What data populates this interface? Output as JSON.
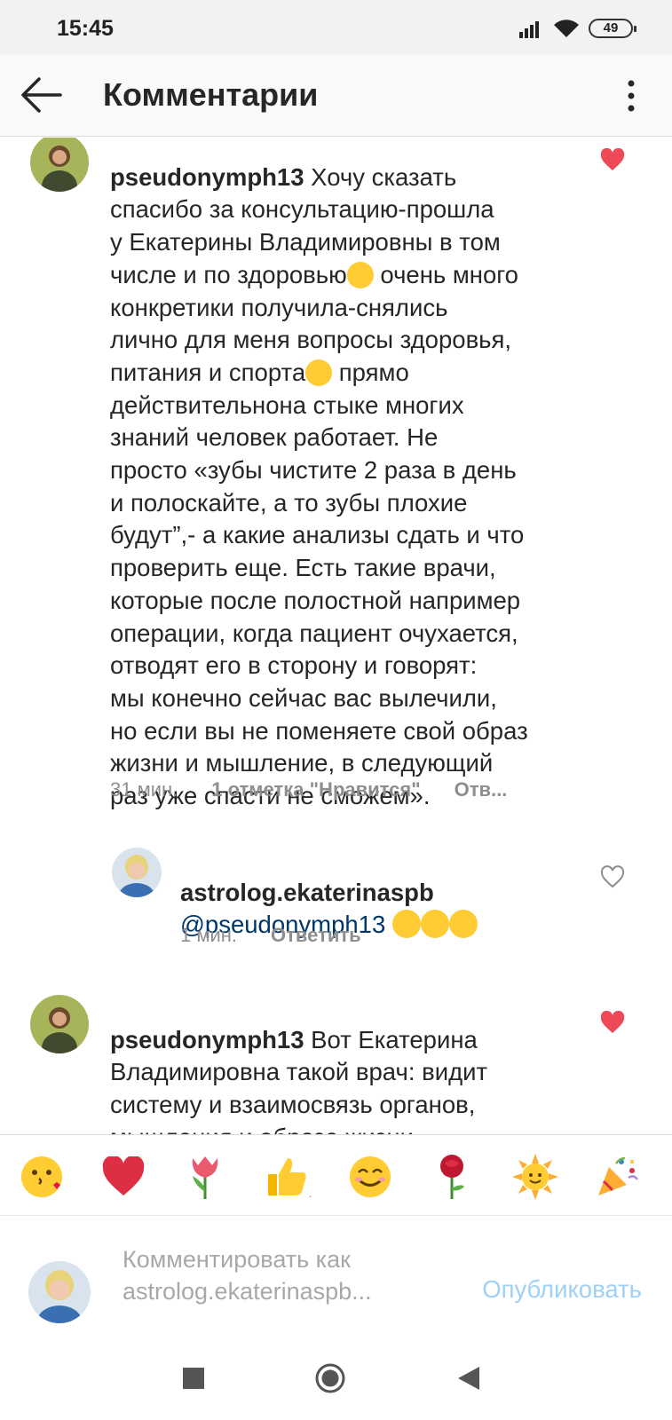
{
  "status_bar": {
    "time": "15:45",
    "battery": "49"
  },
  "header": {
    "title": "Комментарии"
  },
  "comments": [
    {
      "username": "pseudonymph13",
      "text_lines": [
        " Хочу сказать",
        "спасибо за консультацию-прошла",
        "у Екатерины Владимировны в том",
        "числе и по здоровью",
        " очень много",
        "конкретики получила-снялись",
        "лично для меня вопросы здоровья,",
        "питания и спорта",
        " прямо",
        "действительнона стыке многих",
        "знаний человек работает. Не",
        "просто «зубы чистите 2 раза в день",
        "и полоскайте, а то зубы плохие",
        "будут”,- а какие анализы сдать и что",
        "проверить еще. Есть такие врачи,",
        "которые после полостной например",
        "операции, когда пациент очухается,",
        "отводят его в сторону и  говорят:",
        "мы конечно сейчас вас вылечили,",
        "но если вы не поменяете свой образ",
        "жизни и мышление, в следующий",
        "раз уже спасти не сможем»."
      ],
      "time": "31 мин.",
      "likes": "1 отметка \"Нравится\"",
      "reply": "Отв...",
      "liked": true
    },
    {
      "username": "astrolog.ekaterinaspb",
      "mention": "@pseudonymph13",
      "time": "1 мин.",
      "reply": "Ответить",
      "liked": false
    },
    {
      "username": "pseudonymph13",
      "text_lines": [
        " Вот Екатерина",
        "Владимировна такой врач: видит",
        "систему и взаимосвязь органов,",
        "мышления и образа жизни"
      ],
      "liked": true
    }
  ],
  "emoji_bar": [
    "kissing-face",
    "red-heart",
    "tulip",
    "thumbs-up",
    "smiling-face",
    "rose",
    "sun",
    "party-popper"
  ],
  "compose": {
    "placeholder": "Комментировать как\nastrolog.ekaterinaspb...",
    "publish": "Опубликовать"
  },
  "colors": {
    "accent": "#0095f6",
    "publish_disabled": "#9ed1f7",
    "heart": "#ed4956",
    "text": "#262626",
    "meta": "#8e8e8e"
  }
}
